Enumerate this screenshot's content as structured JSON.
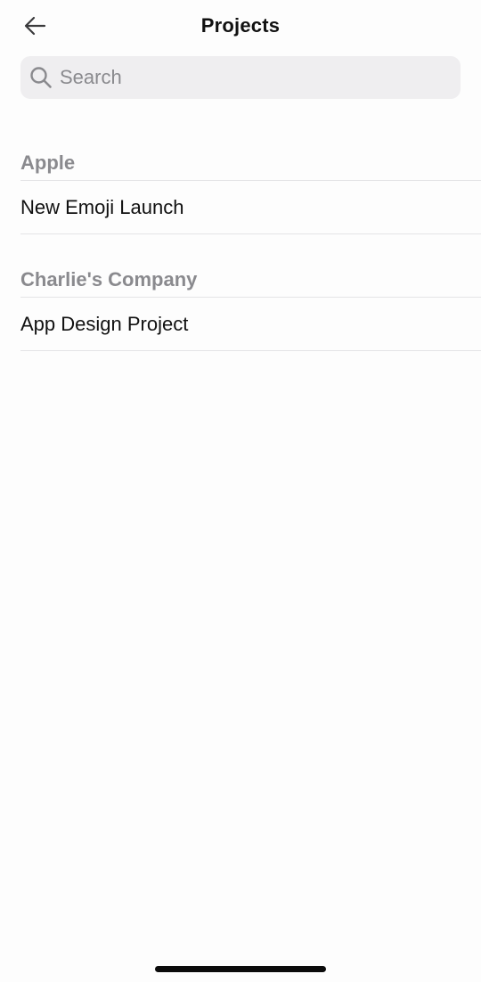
{
  "header": {
    "title": "Projects",
    "back_icon": "arrow-left-icon"
  },
  "search": {
    "placeholder": "Search",
    "value": "",
    "icon": "search-icon"
  },
  "sections": [
    {
      "title": "Apple",
      "items": [
        {
          "label": "New Emoji Launch"
        }
      ]
    },
    {
      "title": "Charlie's Company",
      "items": [
        {
          "label": "App Design Project"
        }
      ]
    }
  ],
  "colors": {
    "background": "#fdfdfd",
    "search_background": "#efeef0",
    "section_header_text": "#8a8a8e",
    "divider": "#e4e4e6",
    "primary_text": "#111111"
  }
}
